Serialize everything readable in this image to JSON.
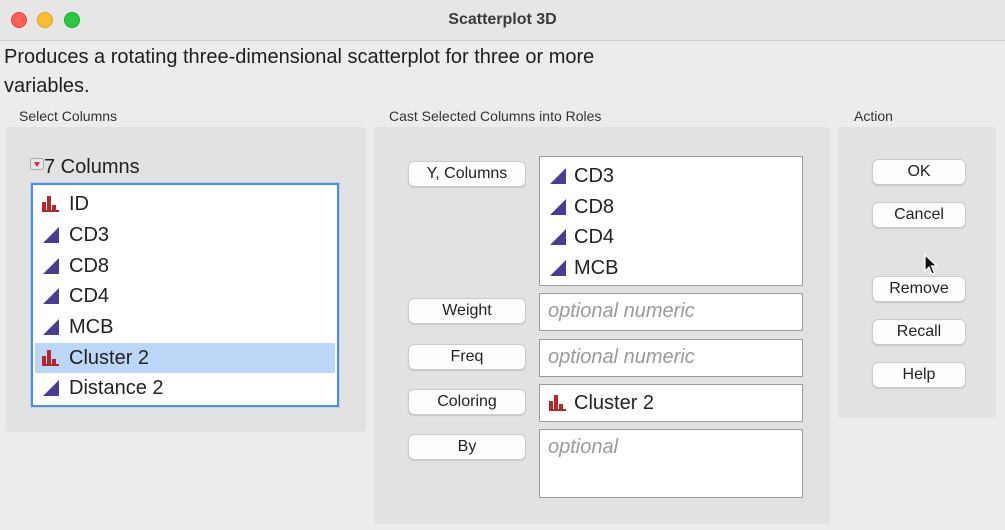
{
  "window": {
    "title": "Scatterplot 3D"
  },
  "description": "Produces a rotating three-dimensional scatterplot for three or more variables.",
  "select_columns": {
    "label": "Select Columns",
    "header": "7 Columns",
    "items": [
      {
        "name": "ID",
        "type": "nominal"
      },
      {
        "name": "CD3",
        "type": "continuous"
      },
      {
        "name": "CD8",
        "type": "continuous"
      },
      {
        "name": "CD4",
        "type": "continuous"
      },
      {
        "name": "MCB",
        "type": "continuous"
      },
      {
        "name": "Cluster 2",
        "type": "nominal",
        "selected": true
      },
      {
        "name": "Distance 2",
        "type": "continuous"
      }
    ]
  },
  "roles": {
    "label": "Cast Selected Columns into Roles",
    "y_columns": {
      "button": "Y, Columns",
      "items": [
        "CD3",
        "CD8",
        "CD4",
        "MCB"
      ]
    },
    "weight": {
      "button": "Weight",
      "placeholder": "optional numeric"
    },
    "freq": {
      "button": "Freq",
      "placeholder": "optional numeric"
    },
    "coloring": {
      "button": "Coloring",
      "value": "Cluster 2"
    },
    "by": {
      "button": "By",
      "placeholder": "optional"
    }
  },
  "action": {
    "label": "Action",
    "ok": "OK",
    "cancel": "Cancel",
    "remove": "Remove",
    "recall": "Recall",
    "help": "Help"
  },
  "colors": {
    "continuous_icon": "#4a3c94",
    "nominal_icon": "#b3262c",
    "selection": "#bcd6f7",
    "focus_border": "#4a8ee8"
  },
  "icons": {
    "continuous": "continuous-triangle-icon",
    "nominal": "nominal-bars-icon",
    "disclosure": "disclosure-triangle-icon"
  }
}
